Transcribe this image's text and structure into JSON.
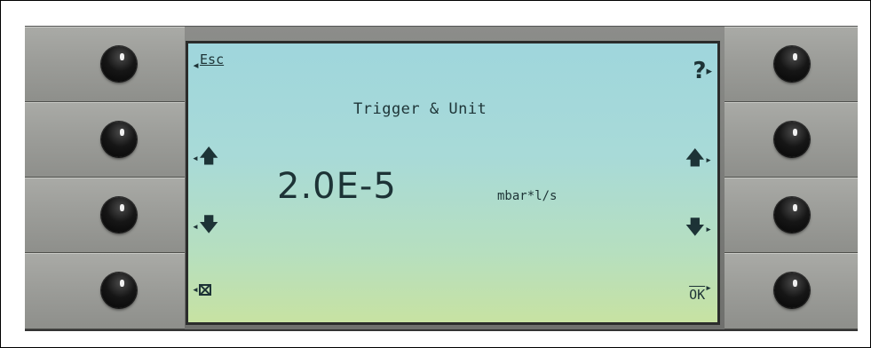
{
  "screen": {
    "title": "Trigger & Unit",
    "value": "2.0E-5",
    "unit": "mbar*l/s"
  },
  "softkeys": {
    "left": [
      {
        "label": "Esc",
        "icon": "esc"
      },
      {
        "label": "",
        "icon": "arrow-up"
      },
      {
        "label": "",
        "icon": "arrow-down"
      },
      {
        "label": "",
        "icon": "clear-box"
      }
    ],
    "right": [
      {
        "label": "?",
        "icon": "help"
      },
      {
        "label": "",
        "icon": "arrow-up"
      },
      {
        "label": "",
        "icon": "arrow-down"
      },
      {
        "label": "OK",
        "icon": "ok"
      }
    ]
  },
  "glyphs": {
    "pointer_left": "◂",
    "pointer_right": "▸",
    "up": "🡅",
    "down": "🡇"
  },
  "colors": {
    "lcd_text": "#1d3336",
    "lcd_background": "#a8dad8",
    "housing": "#9c9d99",
    "knob": "#111111"
  }
}
